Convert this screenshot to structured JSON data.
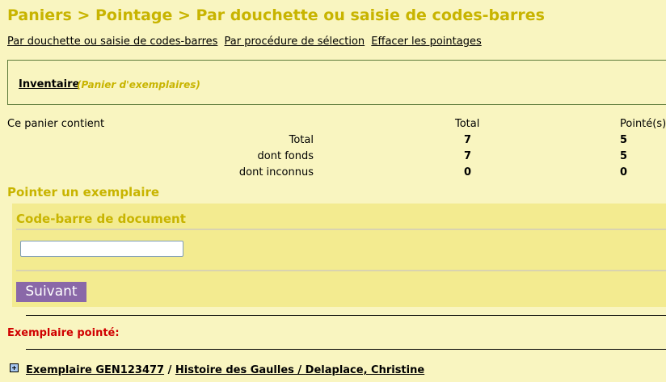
{
  "header": {
    "title": "Paniers > Pointage > Par douchette ou saisie de codes-barres"
  },
  "top_links": [
    "Par douchette ou saisie de codes-barres",
    "Par procédure de sélection",
    "Effacer les pointages"
  ],
  "panier": {
    "name": "Inventaire",
    "type": "(Panier d'exemplaires)"
  },
  "stats": {
    "intro": "Ce panier contient",
    "col_total": "Total",
    "col_pointes": "Pointé(s)",
    "rows": [
      {
        "label": "Total",
        "total": "7",
        "pointes": "5"
      },
      {
        "label": "dont fonds",
        "total": "7",
        "pointes": "5"
      },
      {
        "label": "dont inconnus",
        "total": "0",
        "pointes": "0"
      }
    ]
  },
  "pointer": {
    "section_title": "Pointer un exemplaire",
    "field_legend": "Code-barre de document",
    "field_value": "",
    "submit_label": "Suivant"
  },
  "result": {
    "label": "Exemplaire pointé:",
    "item_link": "Exemplaire GEN123477",
    "separator": "/",
    "notice_link": "Histoire des Gaulles / Delaplace, Christine"
  },
  "colors": {
    "background": "#f9f5c0",
    "accent": "#c8b400",
    "form_background": "#f3eb90",
    "button": "#8a68a8",
    "alert": "#d00000"
  }
}
